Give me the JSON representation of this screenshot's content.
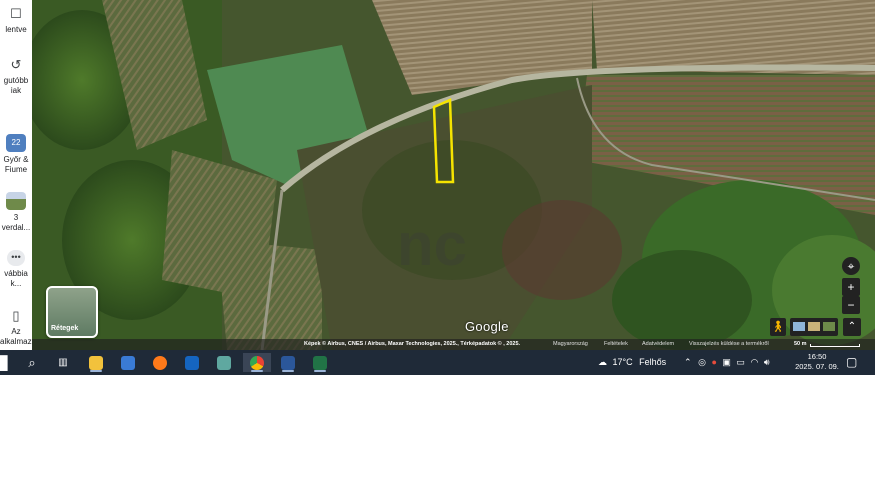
{
  "sidebar": {
    "items": [
      {
        "label": "lentve",
        "icon": "bookmark-icon"
      },
      {
        "label": "gutóbb iak",
        "icon": "history-icon"
      },
      {
        "label": "Győr & Fiume",
        "icon": "calendar-thumb",
        "badge": "22"
      },
      {
        "label": "3 verdal...",
        "icon": "photo-thumb"
      },
      {
        "label": "vábbia k...",
        "icon": "more-icon"
      },
      {
        "label": "Az alkalmaz...",
        "icon": "phone-icon"
      }
    ]
  },
  "map": {
    "watermark": "Google",
    "layers_label": "Rétegek",
    "attribution": "Képek © Airbus, CNES / Airbus, Maxar Technologies, 2025., Térképadatok © , 2025.",
    "footer_links": [
      "Magyarország",
      "Feltételek",
      "Adatvédelem",
      "Visszajelzés küldése a termékről"
    ],
    "scale": "50 m",
    "highlight_color": "#f5e400"
  },
  "taskbar": {
    "weather_temp": "17°C",
    "weather_text": "Felhős",
    "time": "16:50",
    "date": "2025. 07. 09."
  }
}
